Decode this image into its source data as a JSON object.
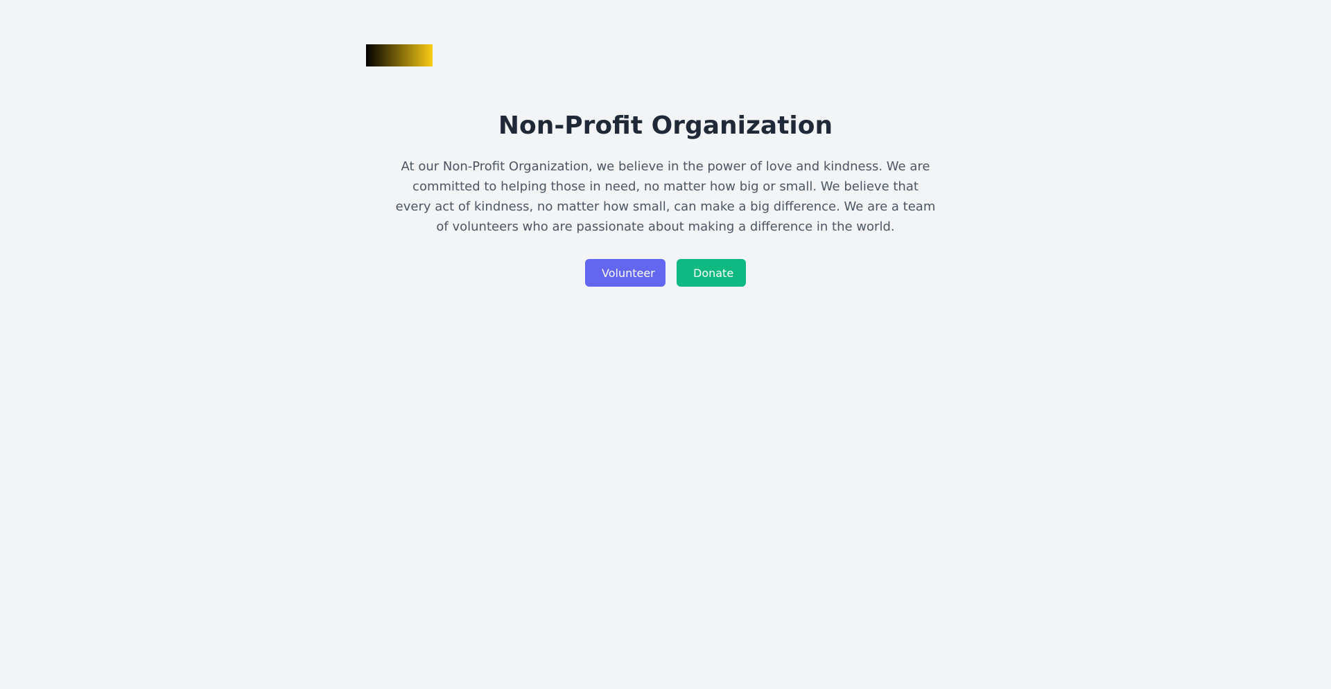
{
  "colors": {
    "background": "#f3f4f6",
    "title": "#1f2937",
    "text": "#4b5563",
    "volunteer_button": "#6366f1",
    "donate_button": "#10b981",
    "logo_gradient_start": "#000000",
    "logo_gradient_end": "#facc15"
  },
  "header": {
    "logo_icon": "gradient-logo"
  },
  "hero": {
    "title": "Non-Profit Organization",
    "description": "At our Non-Profit Organization, we believe in the power of love and kindness. We are committed to helping those in need, no matter how big or small. We believe that every act of kindness, no matter how small, can make a big difference. We are a team of volunteers who are passionate about making a difference in the world."
  },
  "actions": {
    "volunteer_label": "Volunteer",
    "donate_label": "Donate"
  }
}
